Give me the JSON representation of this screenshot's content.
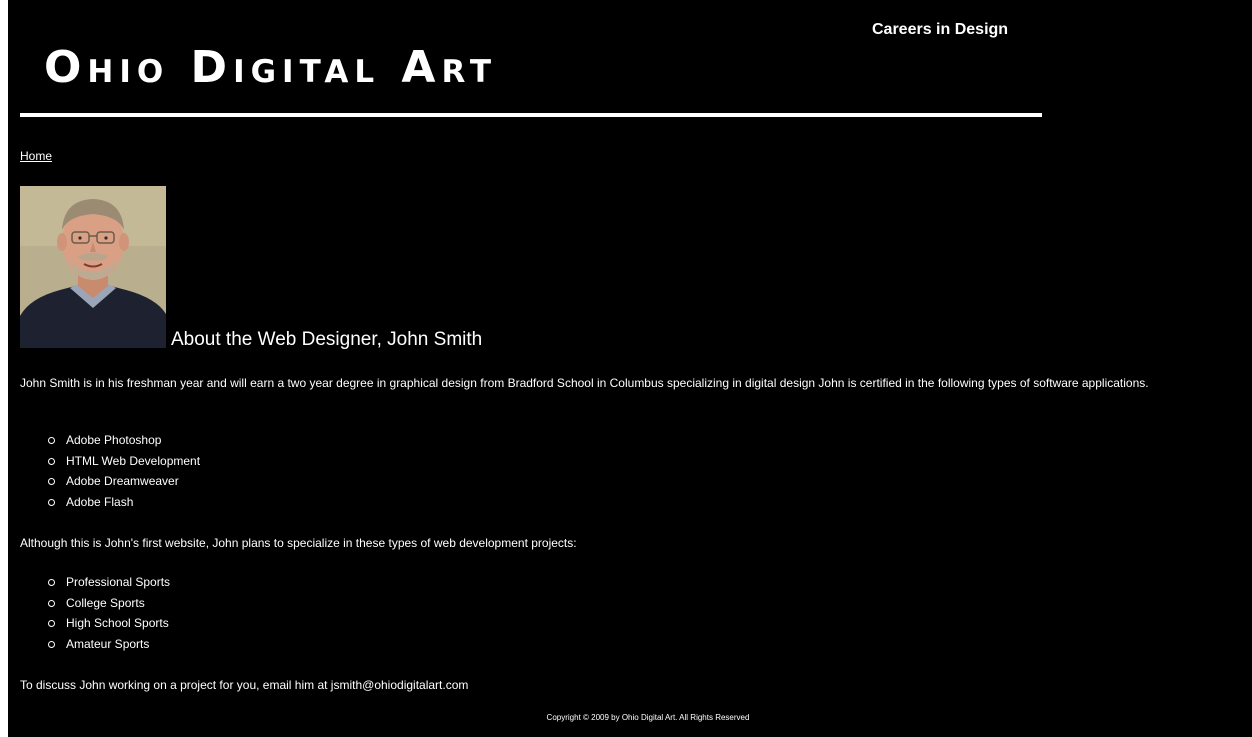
{
  "header": {
    "tagline": "Careers in Design",
    "site_title": "Ohio Digital Art"
  },
  "nav": {
    "home_link": "Home"
  },
  "profile": {
    "heading": "About the Web Designer, John Smith",
    "intro": "John Smith is in his freshman year and will earn a two year degree in graphical design from Bradford School in Columbus specializing in digital design John is certified in the following types of software applications.",
    "software": [
      "Adobe Photoshop",
      "HTML Web Development",
      "Adobe Dreamweaver",
      "Adobe Flash"
    ],
    "specialize_intro": "Although this is John's first website, John plans to specialize in these types of web development projects:",
    "projects": [
      "Professional Sports",
      "College Sports",
      "High School Sports",
      "Amateur Sports"
    ],
    "contact": "To discuss John working on a project for you, email him at jsmith@ohiodigitalart.com"
  },
  "footer": {
    "copyright": "Copyright © 2009 by Ohio Digital Art. All Rights Reserved"
  },
  "colors": {
    "background": "#000000",
    "text": "#ffffff"
  }
}
